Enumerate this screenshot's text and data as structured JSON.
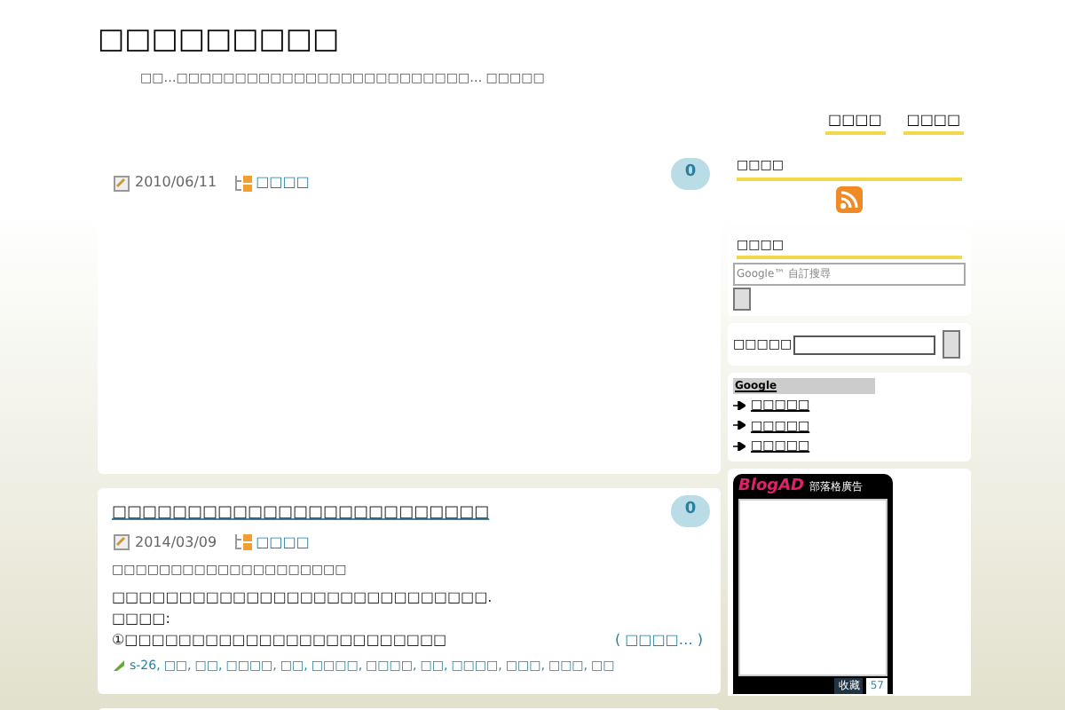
{
  "site": {
    "title": "□□□□□□□□□",
    "tagline": "□□…□□□□□□□□□□□□□□□□□□□□□□□□□… □□□□□"
  },
  "nav": [
    {
      "label": "□□□□"
    },
    {
      "label": "□□□□"
    }
  ],
  "posts": [
    {
      "date": "2010/06/11",
      "category": "□□□□",
      "comments": "0"
    },
    {
      "title": "□□□□□□□□□□□□□□□□□□□□□□□□□",
      "date": "2014/03/09",
      "category": "□□□□",
      "comments": "0",
      "lines": [
        "□□□□□□□□□□□□□□□□□□□□",
        "□□□□□□□□□□□□□□□□□□□□□□□□□□□□.",
        "□□□□:",
        "①□□□□□□□□□□□□□□□□□□□□□□□□"
      ],
      "more": "( □□□□… )",
      "tags": [
        "s-26,",
        "□□,",
        "□□,",
        "□□□□,",
        "□□,",
        "□□□□,",
        "□□□□,",
        "□□,",
        "□□□□,",
        "□□□,",
        "□□□,",
        "□□"
      ]
    }
  ],
  "sidebar": {
    "feed": {
      "heading": "□□□□"
    },
    "search": {
      "heading": "□□□□",
      "placeholder": "Google™ 自訂搜尋"
    },
    "site_search": {
      "label": "□□□□□"
    },
    "links": {
      "heading": "Google",
      "items": [
        "□□□□□",
        "□□□□□",
        "□□□□□"
      ]
    },
    "ad": {
      "brand": "BlogAD",
      "caption": "部落格廣告",
      "save": "收藏",
      "count": "57"
    }
  }
}
